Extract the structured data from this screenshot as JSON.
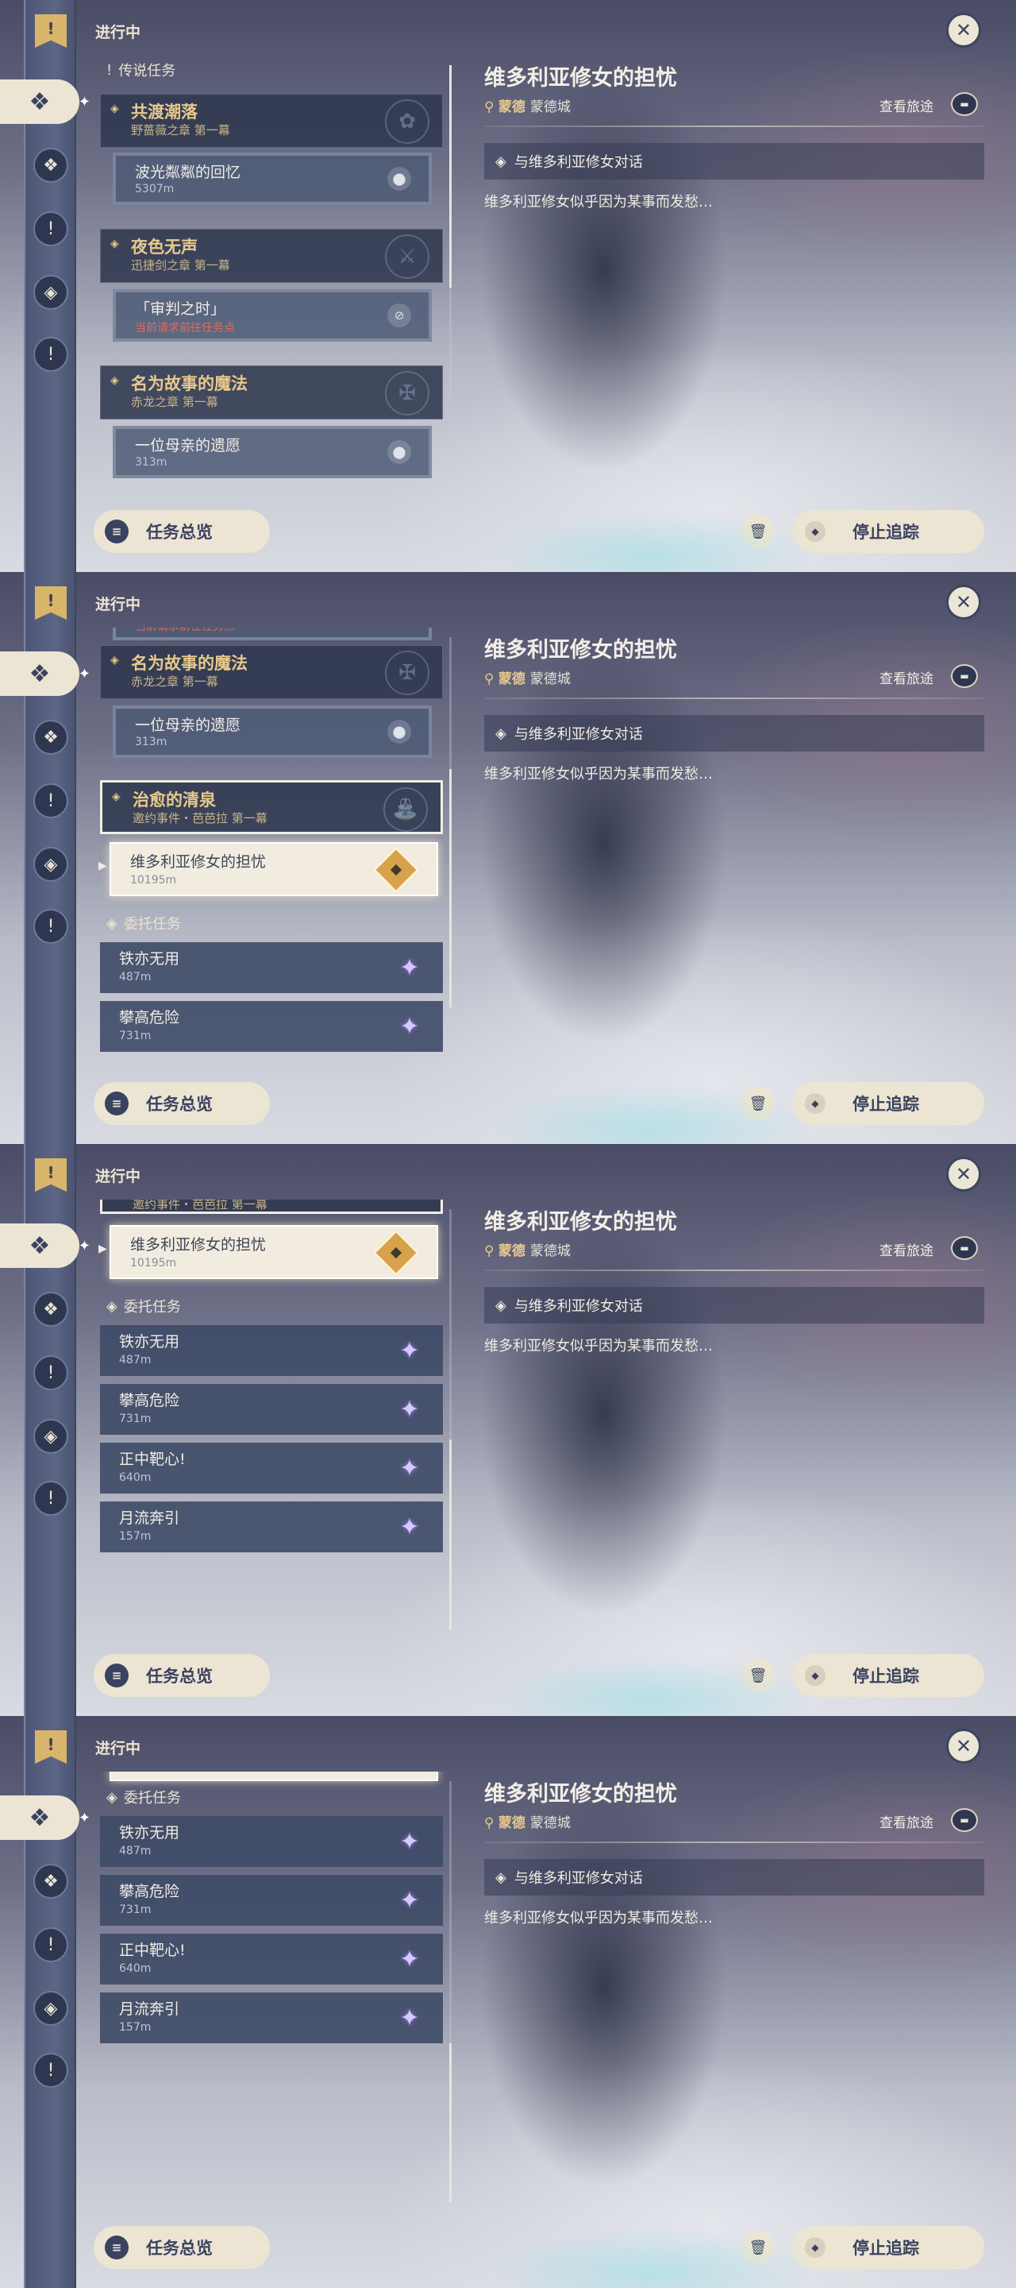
{
  "ui": {
    "in_progress": "进行中",
    "close_glyph": "✕",
    "overview_label": "任务总览",
    "stop_label": "停止追踪",
    "view_journey": "查看旅途"
  },
  "detail": {
    "title": "维多利亚修女的担忧",
    "location": "蒙德",
    "location_city": "蒙德城",
    "objective": "与维多利亚修女对话",
    "description": "维多利亚修女似乎因为某事而发愁…"
  },
  "sections": {
    "legend": "传说任务",
    "commission": "委托任务"
  },
  "groups": {
    "g1": {
      "title": "共渡潮落",
      "subtitle": "野蔷薇之章 第一幕"
    },
    "g2": {
      "title": "夜色无声",
      "subtitle": "迅捷剑之章 第一幕"
    },
    "g3": {
      "title": "名为故事的魔法",
      "subtitle": "赤龙之章 第一幕"
    },
    "g4": {
      "title": "治愈的清泉",
      "subtitle": "邀约事件・芭芭拉 第一幕"
    }
  },
  "subs": {
    "s1": {
      "title": "波光粼粼的回忆",
      "meta": "5307m"
    },
    "s2": {
      "title": "「审判之时」",
      "meta": "当前请求前往任务点"
    },
    "s3": {
      "title": "一位母亲的遗愿",
      "meta": "313m"
    },
    "active": {
      "title": "维多利亚修女的担忧",
      "meta": "10195m"
    }
  },
  "commissions": [
    {
      "title": "铁亦无用",
      "meta": "487m"
    },
    {
      "title": "攀高危险",
      "meta": "731m"
    },
    {
      "title": "正中靶心!",
      "meta": "640m"
    },
    {
      "title": "月流奔引",
      "meta": "157m"
    }
  ],
  "icons": {
    "rail_active": "map-marker-icon",
    "rail": [
      "compass-icon",
      "exclamation-icon",
      "diamond-icon",
      "exclamation-icon"
    ],
    "commission_star": "purple-star-icon"
  }
}
